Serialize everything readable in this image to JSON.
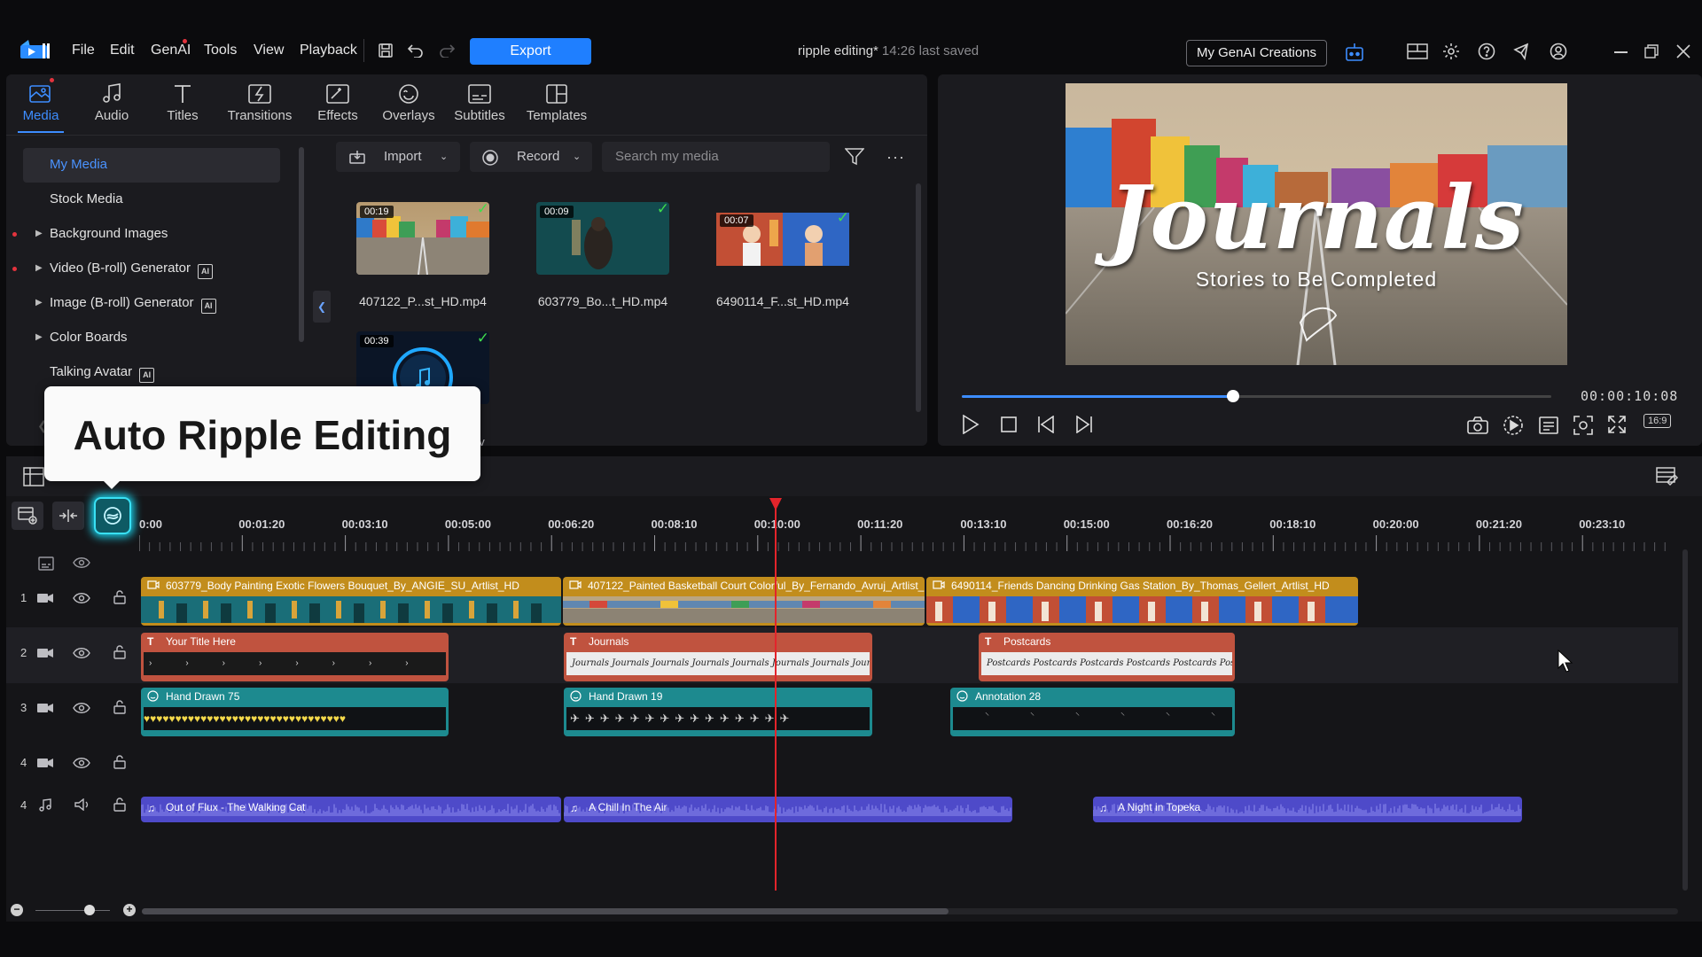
{
  "menu": [
    "File",
    "Edit",
    "GenAI",
    "Tools",
    "View",
    "Playback"
  ],
  "toolbar": {
    "export_label": "Export",
    "genai_creations_label": "My GenAI Creations"
  },
  "project": {
    "title": "ripple editing*",
    "saved": "14:26 last saved"
  },
  "tabs": [
    {
      "label": "Media",
      "icon": "media-icon"
    },
    {
      "label": "Audio",
      "icon": "music-note-icon"
    },
    {
      "label": "Titles",
      "icon": "title-t-icon"
    },
    {
      "label": "Transitions",
      "icon": "transitions-icon"
    },
    {
      "label": "Effects",
      "icon": "effects-icon"
    },
    {
      "label": "Overlays",
      "icon": "overlays-icon"
    },
    {
      "label": "Subtitles",
      "icon": "subtitles-icon"
    },
    {
      "label": "Templates",
      "icon": "templates-icon"
    }
  ],
  "library": {
    "items": [
      {
        "label": "My Media"
      },
      {
        "label": "Stock Media"
      },
      {
        "label": "Background Images"
      },
      {
        "label": "Video (B-roll) Generator"
      },
      {
        "label": "Image (B-roll) Generator"
      },
      {
        "label": "Color Boards"
      },
      {
        "label": "Talking Avatar"
      }
    ]
  },
  "media_toolbar": {
    "import_label": "Import",
    "record_label": "Record",
    "search_placeholder": "Search my media"
  },
  "media": [
    {
      "name": "407122_P...st_HD.mp4",
      "duration": "00:19"
    },
    {
      "name": "603779_Bo...t_HD.mp4",
      "duration": "00:09"
    },
    {
      "name": "6490114_F...st_HD.mp4",
      "duration": "00:07"
    },
    {
      "name": "",
      "duration": "00:39"
    }
  ],
  "media_partial_text": "av",
  "preview": {
    "title": "Journals",
    "subtitle": "Stories to Be Completed",
    "timecode": "00:00:10:08",
    "aspect": "16:9",
    "progress": 0.46
  },
  "tooltip": {
    "text": "Auto Ripple Editing"
  },
  "timeline": {
    "ruler": [
      "0:00",
      "00:01:20",
      "00:03:10",
      "00:05:00",
      "00:06:20",
      "00:08:10",
      "00:10:00",
      "00:11:20",
      "00:13:10",
      "00:15:00",
      "00:16:20",
      "00:18:10",
      "00:20:00",
      "00:21:20",
      "00:23:10"
    ],
    "track_numbers": [
      "1",
      "2",
      "3",
      "4",
      "4"
    ],
    "clips": {
      "video": [
        "603779_Body Painting Exotic Flowers Bouquet_By_ANGIE_SU_Artlist_HD",
        "407122_Painted Basketball Court Colorful_By_Fernando_Avruj_Artlist_HD",
        "6490114_Friends Dancing Drinking Gas Station_By_Thomas_Gellert_Artlist_HD"
      ],
      "titles": [
        "Your Title Here",
        "Journals",
        "Postcards"
      ],
      "overlays": [
        "Hand Drawn 75",
        "Hand Drawn 19",
        "Annotation 28"
      ],
      "audio": [
        "Out of Flux - The Walking Cat",
        "A Chill In The Air",
        "A Night in Topeka"
      ]
    },
    "title_strip_words": [
      "Journals",
      "Postcards"
    ]
  },
  "colors": {
    "accent": "#1f7fff",
    "video_clip": "#c28d1c",
    "title_clip": "#c0533f",
    "overlay_clip": "#1d8a8f",
    "audio_clip": "#5a55d8",
    "playhead": "#e3242b"
  }
}
